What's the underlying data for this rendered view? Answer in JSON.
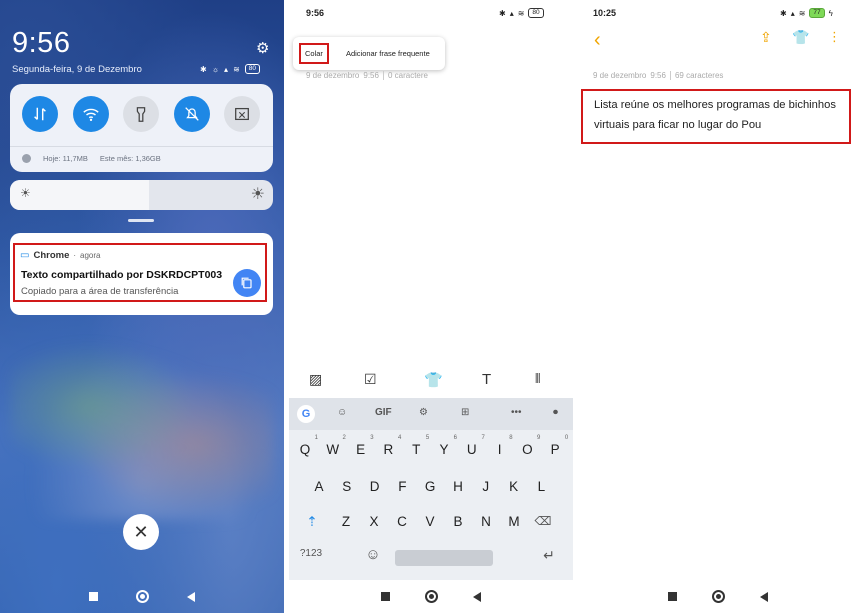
{
  "lockscreen": {
    "time": "9:56",
    "date": "Segunda-feira, 9 de Dezembro",
    "battery": "80",
    "usage": {
      "today": "Hoje: 11,7MB",
      "month": "Este mês: 1,36GB"
    },
    "brightness_level": 0.53,
    "quick_toggles": [
      {
        "name": "mobile-data",
        "active": true
      },
      {
        "name": "wifi",
        "active": true
      },
      {
        "name": "flashlight",
        "active": false
      },
      {
        "name": "silent",
        "active": true
      },
      {
        "name": "screenshot",
        "active": false
      }
    ],
    "notification": {
      "app": "Chrome",
      "when": "agora",
      "title": "Texto compartilhado por DSKRDCPT003",
      "body": "Copiado para a área de transferência"
    },
    "colors": {
      "accent": "#1e88e5",
      "highlight": "#d11919"
    }
  },
  "editor_paste": {
    "time": "9:56",
    "battery": "80",
    "popup": {
      "paste": "Colar",
      "add_phrase": "Adicionar frase frequente"
    },
    "meta": {
      "date": "9 de dezembro",
      "time": "9:56",
      "chars": "0 caractere"
    },
    "keyboard": {
      "row1": [
        "Q",
        "W",
        "E",
        "R",
        "T",
        "Y",
        "U",
        "I",
        "O",
        "P"
      ],
      "row1_hints": [
        "1",
        "2",
        "3",
        "4",
        "5",
        "6",
        "7",
        "8",
        "9",
        "0"
      ],
      "row2": [
        "A",
        "S",
        "D",
        "F",
        "G",
        "H",
        "J",
        "K",
        "L"
      ],
      "row3": [
        "Z",
        "X",
        "C",
        "V",
        "B",
        "N",
        "M"
      ],
      "symbols": "?123",
      "gif": "GIF"
    }
  },
  "editor_note": {
    "time": "10:25",
    "battery": "77",
    "meta": {
      "date": "9 de dezembro",
      "time": "9:56",
      "chars": "69 caracteres"
    },
    "note_text": "Lista reúne os melhores programas de bichinhos virtuais para ficar no lugar do Pou",
    "colors": {
      "accent": "#f0a500"
    }
  }
}
